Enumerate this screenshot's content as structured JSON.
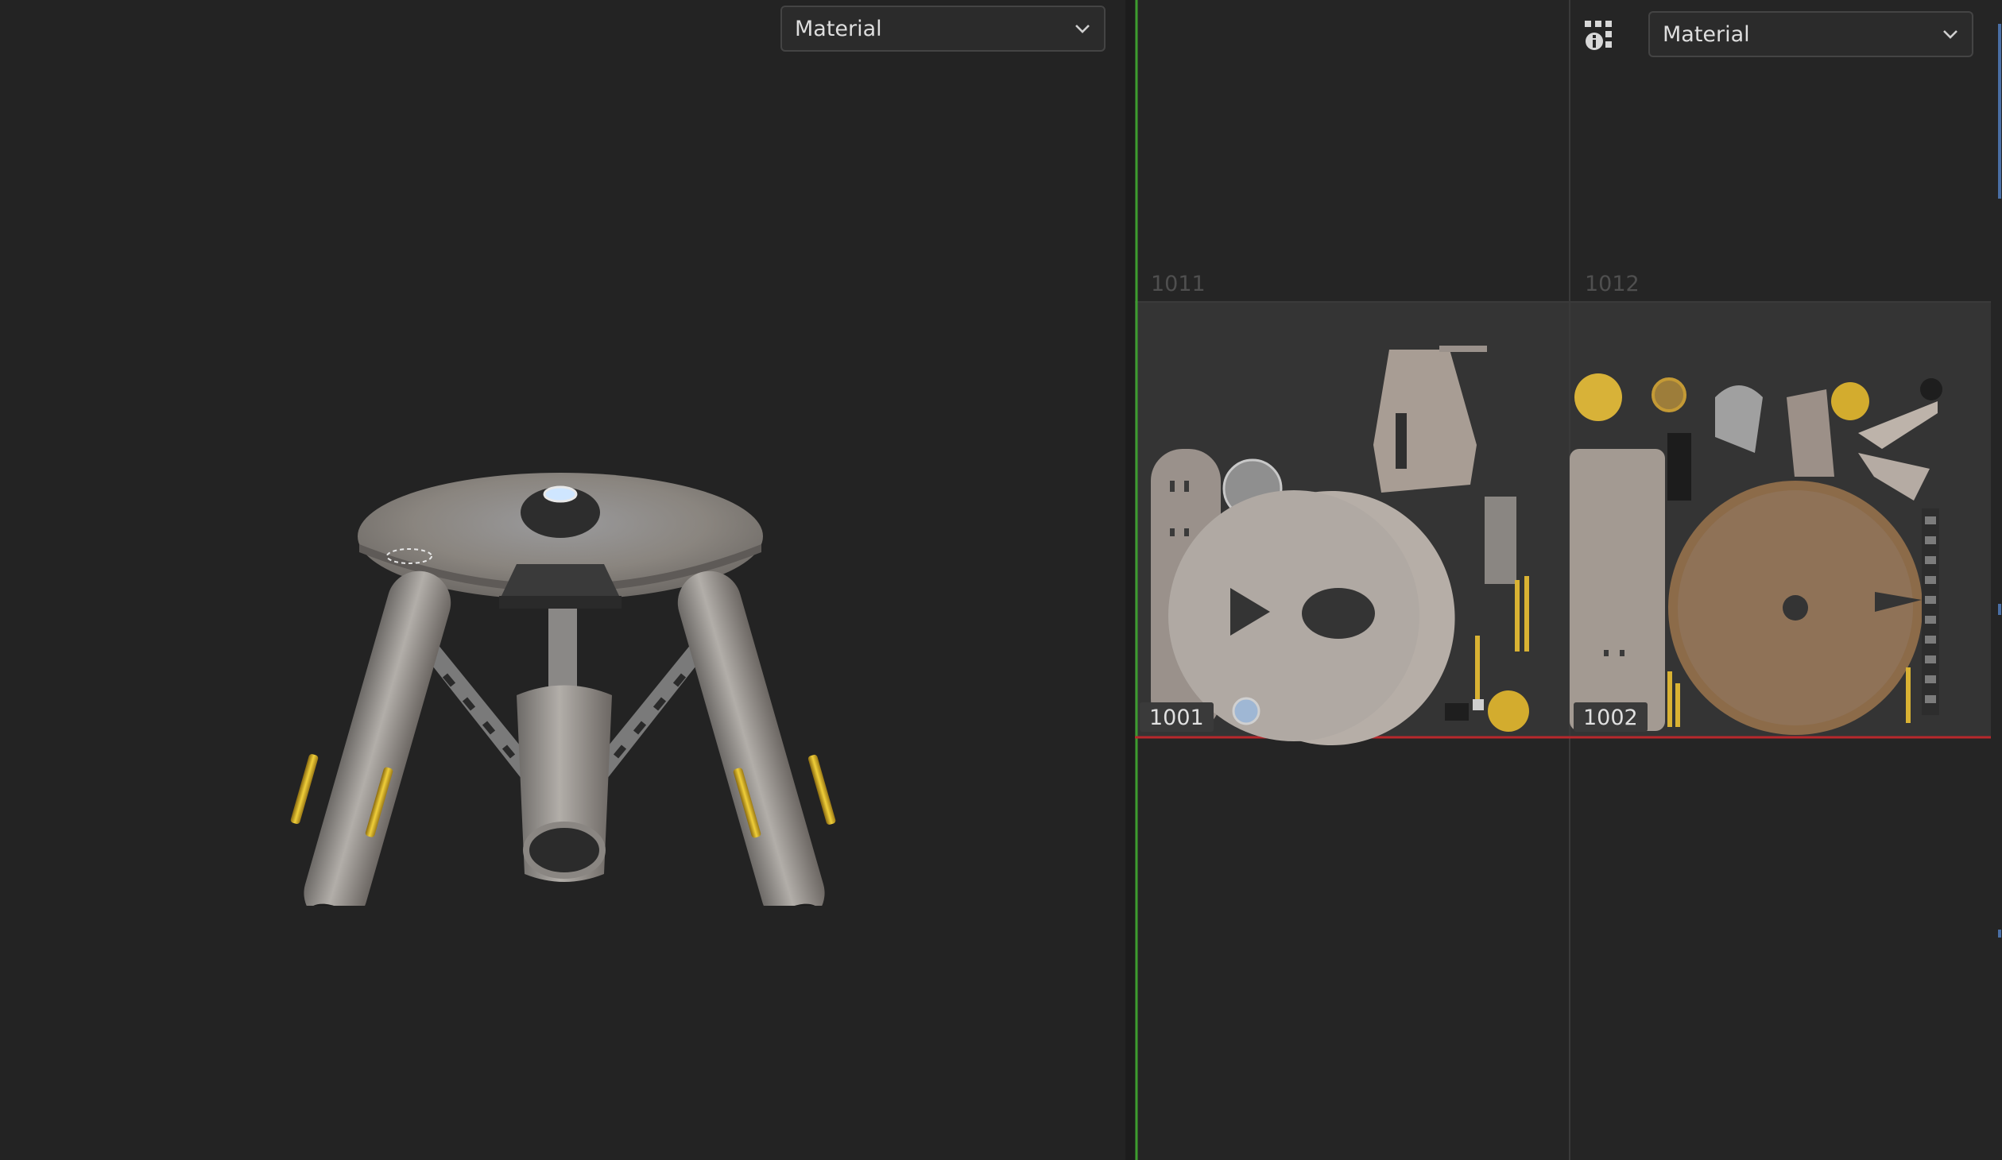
{
  "viewport": {
    "shading_dropdown": {
      "label": "Material",
      "icon": "chevron-down-icon"
    }
  },
  "uv_editor": {
    "tools_icon": "grid-info-icon",
    "shading_dropdown": {
      "label": "Material",
      "icon": "chevron-down-icon"
    },
    "udim_tiles": [
      {
        "label": "1011",
        "style": "inactive"
      },
      {
        "label": "1012",
        "style": "inactive"
      },
      {
        "label": "1001",
        "style": "active"
      },
      {
        "label": "1002",
        "style": "active"
      }
    ],
    "colors": {
      "y_axis": "#3d9d2f",
      "x_axis": "#b8282c",
      "tile_bg": "#343434",
      "grid_line": "#3a3a3a"
    }
  }
}
